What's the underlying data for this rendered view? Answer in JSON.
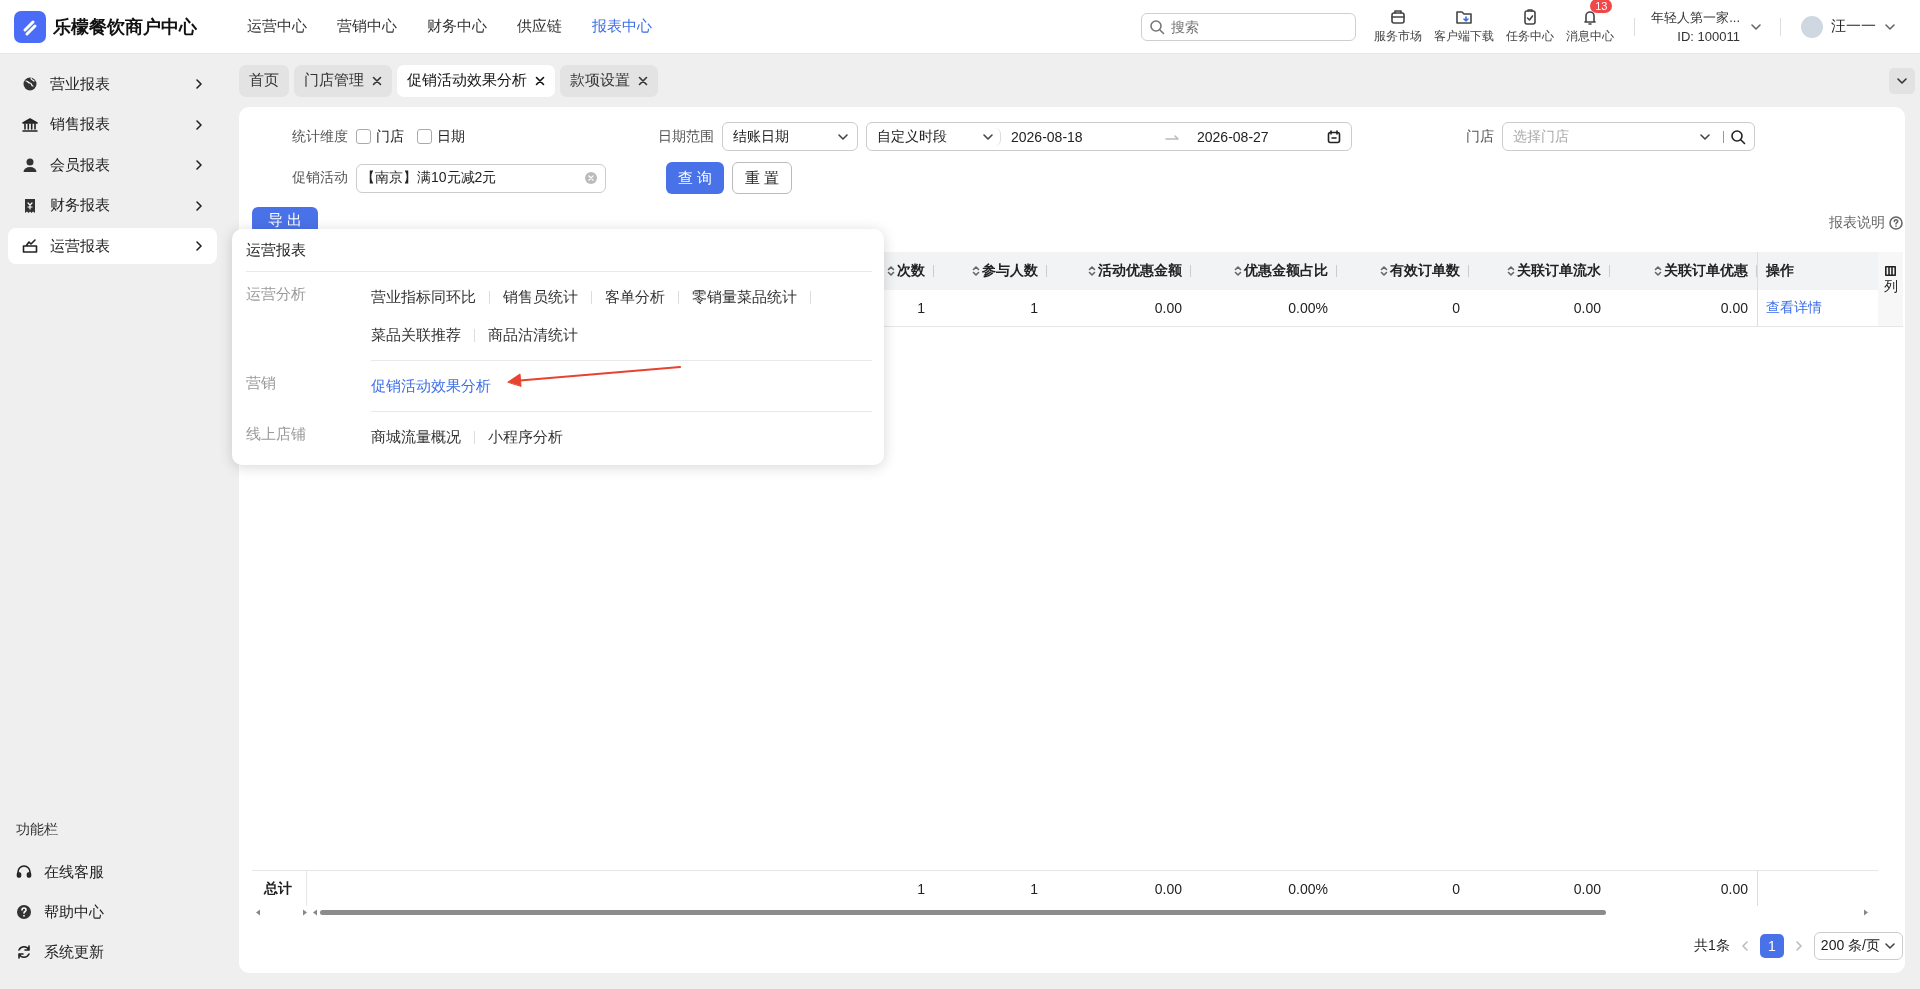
{
  "app": {
    "title": "乐檬餐饮商户中心"
  },
  "top_nav": [
    {
      "label": "运营中心",
      "selected": false
    },
    {
      "label": "营销中心",
      "selected": false
    },
    {
      "label": "财务中心",
      "selected": false
    },
    {
      "label": "供应链",
      "selected": false
    },
    {
      "label": "报表中心",
      "selected": true
    }
  ],
  "search": {
    "placeholder": "搜索"
  },
  "toolbar": [
    {
      "label": "服务市场",
      "kind": "market"
    },
    {
      "label": "客户端下载",
      "kind": "download"
    },
    {
      "label": "任务中心",
      "kind": "task"
    },
    {
      "label": "消息中心",
      "kind": "message",
      "badge": "13"
    }
  ],
  "account": {
    "store": "年轻人第一家...",
    "id": "ID: 100011",
    "user": "汪一一"
  },
  "sidebar": {
    "items": [
      {
        "label": "营业报表",
        "kind": "globe",
        "selected": false
      },
      {
        "label": "销售报表",
        "kind": "bank",
        "selected": false
      },
      {
        "label": "会员报表",
        "kind": "person",
        "selected": false
      },
      {
        "label": "财务报表",
        "kind": "receipt",
        "selected": false
      },
      {
        "label": "运营报表",
        "kind": "chart",
        "selected": true
      }
    ],
    "footer_title": "功能栏",
    "footer_items": [
      {
        "label": "在线客服",
        "kind": "headset"
      },
      {
        "label": "帮助中心",
        "kind": "help"
      },
      {
        "label": "系统更新",
        "kind": "refresh"
      }
    ]
  },
  "tabs": [
    {
      "label": "首页",
      "closable": false,
      "selected": false
    },
    {
      "label": "门店管理",
      "closable": true,
      "selected": false
    },
    {
      "label": "促销活动效果分析",
      "closable": true,
      "selected": true
    },
    {
      "label": "款项设置",
      "closable": true,
      "selected": false
    }
  ],
  "filters": {
    "dimension": {
      "label": "统计维度",
      "options": [
        {
          "label": "门店",
          "checked": false
        },
        {
          "label": "日期",
          "checked": false
        }
      ]
    },
    "date_range": {
      "label": "日期范围",
      "date_type": "结账日期",
      "period": "自定义时段",
      "start": "2026-08-18",
      "end": "2026-08-27"
    },
    "store": {
      "label": "门店",
      "placeholder": "选择门店"
    },
    "promotion": {
      "label": "促销活动",
      "value": "【南京】满10元减2元"
    },
    "buttons": [
      {
        "label": "查询",
        "kind": "primary"
      },
      {
        "label": "重置",
        "kind": "default"
      }
    ]
  },
  "export_button": "导出",
  "report_help": "报表说明",
  "table": {
    "columns": [
      {
        "label": "次数",
        "sortable": true
      },
      {
        "label": "参与人数",
        "sortable": true
      },
      {
        "label": "活动优惠金额",
        "sortable": true
      },
      {
        "label": "优惠金额占比",
        "sortable": true
      },
      {
        "label": "有效订单数",
        "sortable": true
      },
      {
        "label": "关联订单流水",
        "sortable": true
      },
      {
        "label": "关联订单优惠",
        "sortable": true
      },
      {
        "label": "操作",
        "sortable": false
      }
    ],
    "rows": [
      {
        "cells": [
          "1",
          "1",
          "0.00",
          "0.00%",
          "0",
          "0.00",
          "0.00"
        ],
        "action": "查看详情"
      }
    ],
    "total": {
      "label": "总计",
      "cells": [
        "1",
        "1",
        "0.00",
        "0.00%",
        "0",
        "0.00",
        "0.00"
      ]
    },
    "column_settings": "列"
  },
  "popup": {
    "title": "运营报表",
    "groups": [
      {
        "label": "运营分析",
        "links": [
          {
            "label": "营业指标同环比",
            "selected": false
          },
          {
            "label": "销售员统计",
            "selected": false
          },
          {
            "label": "客单分析",
            "selected": false
          },
          {
            "label": "零销量菜品统计",
            "selected": false
          },
          {
            "label": "菜品关联推荐",
            "selected": false
          },
          {
            "label": "商品沽清统计",
            "selected": false
          }
        ]
      },
      {
        "label": "营销",
        "links": [
          {
            "label": "促销活动效果分析",
            "selected": true
          }
        ]
      },
      {
        "label": "线上店铺",
        "links": [
          {
            "label": "商城流量概况",
            "selected": false
          },
          {
            "label": "小程序分析",
            "selected": false
          }
        ]
      }
    ]
  },
  "pagination": {
    "total": "共1条",
    "pages": [
      {
        "label": "1",
        "selected": true
      }
    ],
    "page_size": "200 条/页"
  }
}
